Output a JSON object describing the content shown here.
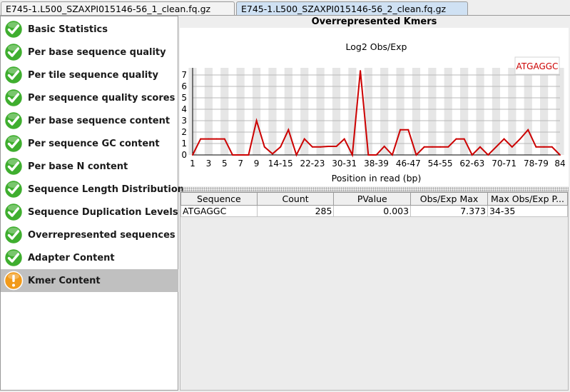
{
  "tabs": [
    {
      "label": "E745-1.L500_SZAXPI015146-56_1_clean.fq.gz",
      "active": false
    },
    {
      "label": "E745-1.L500_SZAXPI015146-56_2_clean.fq.gz",
      "active": true
    }
  ],
  "modules": [
    {
      "label": "Basic Statistics",
      "status": "pass"
    },
    {
      "label": "Per base sequence quality",
      "status": "pass"
    },
    {
      "label": "Per tile sequence quality",
      "status": "pass"
    },
    {
      "label": "Per sequence quality scores",
      "status": "pass"
    },
    {
      "label": "Per base sequence content",
      "status": "pass"
    },
    {
      "label": "Per sequence GC content",
      "status": "pass"
    },
    {
      "label": "Per base N content",
      "status": "pass"
    },
    {
      "label": "Sequence Length Distribution",
      "status": "pass"
    },
    {
      "label": "Sequence Duplication Levels",
      "status": "pass"
    },
    {
      "label": "Overrepresented sequences",
      "status": "pass"
    },
    {
      "label": "Adapter Content",
      "status": "pass"
    },
    {
      "label": "Kmer Content",
      "status": "warn",
      "selected": true
    }
  ],
  "colors": {
    "pass": "#3fae2f",
    "warn": "#f19a1a",
    "line": "#cc0000",
    "stripe": "#e6e6e6",
    "selected": "#c0c0c0"
  },
  "panel_title": "Overrepresented Kmers",
  "chart_data": {
    "type": "line",
    "title": "Log2 Obs/Exp",
    "xlabel": "Position in read (bp)",
    "ylabel": "",
    "ylim": [
      0,
      7
    ],
    "yticks": [
      0,
      1,
      2,
      3,
      4,
      5,
      6,
      7
    ],
    "grid": true,
    "legend": "top-right",
    "categories": [
      "1",
      "2",
      "3",
      "4",
      "5",
      "6",
      "7",
      "8",
      "9",
      "10-11",
      "12-13",
      "14-15",
      "16-17",
      "18-19",
      "20-21",
      "22-23",
      "24-25",
      "26-27",
      "28-29",
      "30-31",
      "32-33",
      "34-35",
      "36-37",
      "38-39",
      "40-41",
      "42-43",
      "44-45",
      "46-47",
      "48-49",
      "50-51",
      "52-53",
      "54-55",
      "56-57",
      "58-59",
      "60-61",
      "62-63",
      "64-65",
      "66-67",
      "68-69",
      "70-71",
      "72-73",
      "74-75",
      "76-77",
      "78-79",
      "80-81",
      "82-83",
      "84"
    ],
    "xticks_shown": [
      "1",
      "3",
      "5",
      "7",
      "9",
      "14-15",
      "22-23",
      "30-31",
      "38-39",
      "46-47",
      "54-55",
      "62-63",
      "70-71",
      "78-79",
      "84"
    ],
    "series": [
      {
        "name": "ATGAGGC",
        "color": "#cc0000",
        "values": [
          0,
          1.4,
          1.4,
          1.4,
          1.4,
          0,
          0,
          0,
          3,
          0.7,
          0.1,
          0.7,
          2.2,
          0,
          1.4,
          0.7,
          0.7,
          0.75,
          0.75,
          1.4,
          0,
          7.37,
          0,
          0,
          0.75,
          0,
          2.2,
          2.2,
          0,
          0.7,
          0.7,
          0.7,
          0.7,
          1.4,
          1.4,
          0,
          0.7,
          0,
          0.7,
          1.4,
          0.7,
          1.4,
          2.2,
          0.7,
          0.7,
          0.7,
          0
        ]
      }
    ]
  },
  "table": {
    "columns": [
      "Sequence",
      "Count",
      "PValue",
      "Obs/Exp Max",
      "Max Obs/Exp P..."
    ],
    "rows": [
      [
        "ATGAGGC",
        "285",
        "0.003",
        "7.373",
        "34-35"
      ]
    ]
  }
}
